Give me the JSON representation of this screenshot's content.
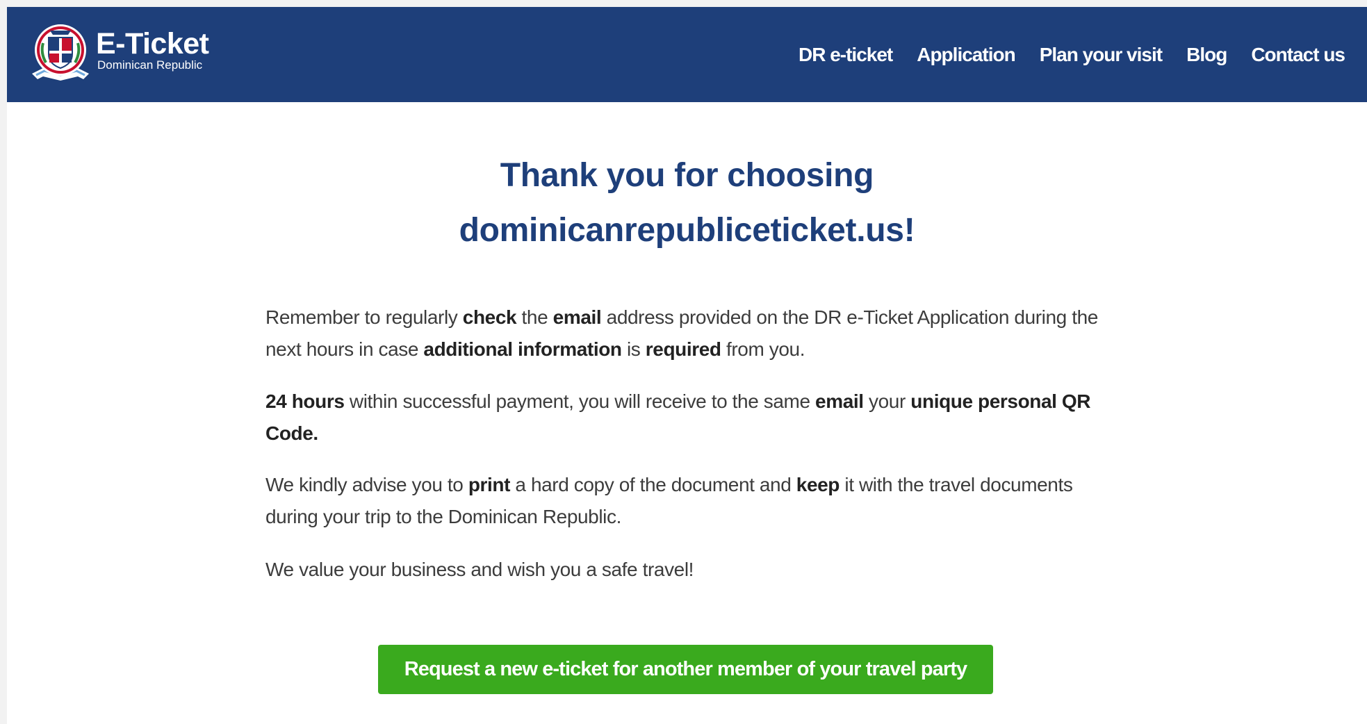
{
  "header": {
    "logo_title": "E-Ticket",
    "logo_subtitle": "Dominican Republic",
    "nav": [
      {
        "label": "DR e-ticket"
      },
      {
        "label": "Application"
      },
      {
        "label": "Plan your visit"
      },
      {
        "label": "Blog"
      },
      {
        "label": "Contact us"
      }
    ]
  },
  "main": {
    "title_line1": "Thank you for choosing",
    "title_line2": "dominicanrepubliceticket.us!",
    "paragraph1": [
      {
        "t": "Remember to regularly ",
        "bold": false
      },
      {
        "t": "check",
        "bold": true
      },
      {
        "t": " the ",
        "bold": false
      },
      {
        "t": "email",
        "bold": true
      },
      {
        "t": " address provided on the DR e-Ticket Application during the next hours in case ",
        "bold": false
      },
      {
        "t": "additional information",
        "bold": true
      },
      {
        "t": " is ",
        "bold": false
      },
      {
        "t": "required",
        "bold": true
      },
      {
        "t": " from you.",
        "bold": false
      }
    ],
    "paragraph2": [
      {
        "t": "24 hours",
        "bold": true
      },
      {
        "t": " within successful payment, you will receive to the same ",
        "bold": false
      },
      {
        "t": "email",
        "bold": true
      },
      {
        "t": " your ",
        "bold": false
      },
      {
        "t": "unique personal QR Code.",
        "bold": true
      }
    ],
    "paragraph3": [
      {
        "t": "We kindly advise you to ",
        "bold": false
      },
      {
        "t": "print",
        "bold": true
      },
      {
        "t": " a hard copy of the document and ",
        "bold": false
      },
      {
        "t": "keep",
        "bold": true
      },
      {
        "t": " it with the travel documents during your trip to the Dominican Republic.",
        "bold": false
      }
    ],
    "paragraph4": [
      {
        "t": "We value your business and wish you a safe travel!",
        "bold": false
      }
    ],
    "cta_label": "Request a new e-ticket for another member of your travel party"
  },
  "colors": {
    "header_bg": "#1e3f7a",
    "title": "#1e3f7a",
    "cta_bg": "#3aaa1e",
    "page_bg": "#f2f2f2"
  },
  "icons": {
    "logo": "dominican-republic-coat-of-arms-icon"
  }
}
